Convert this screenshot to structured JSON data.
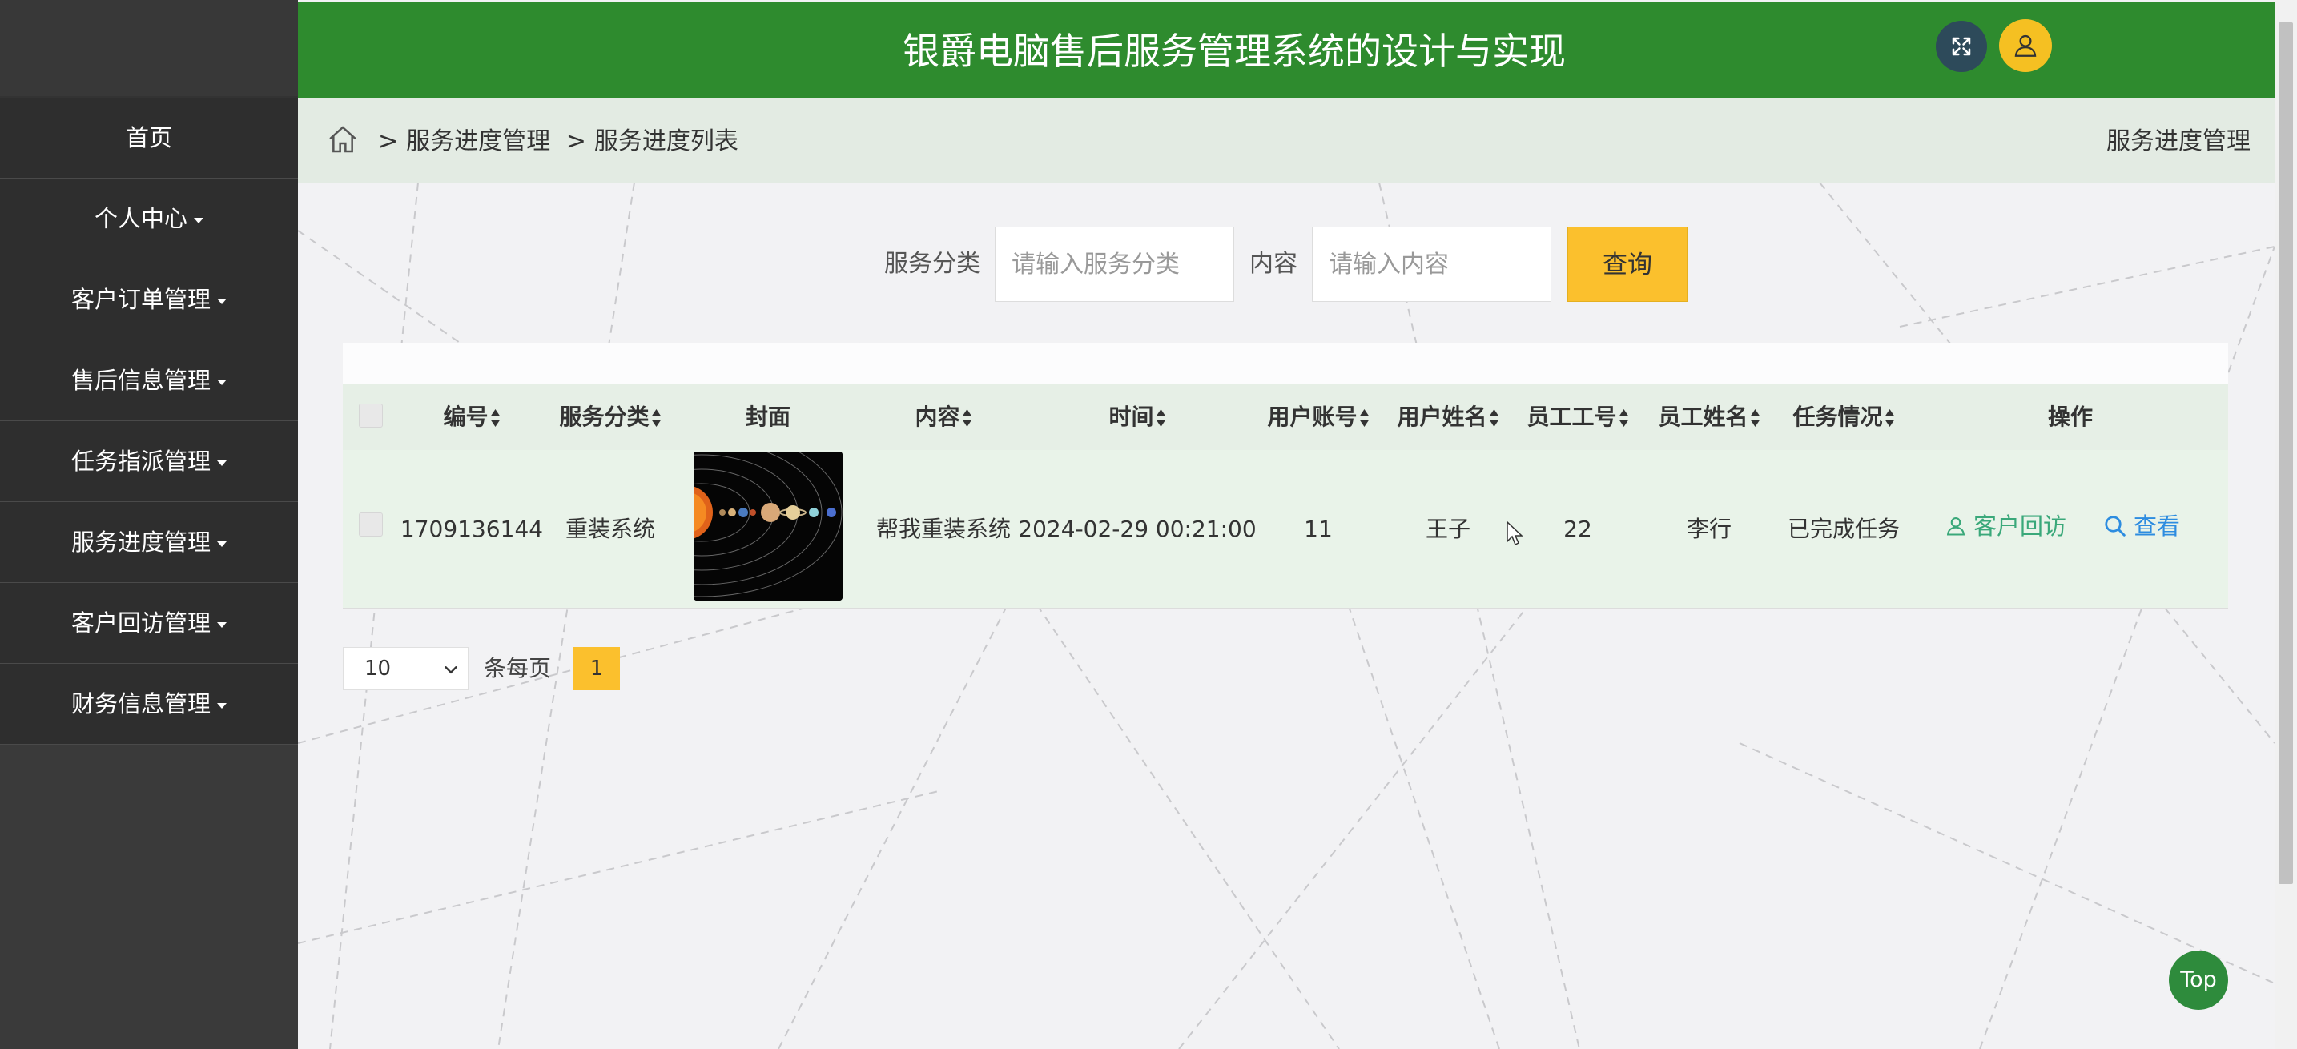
{
  "header": {
    "title": "银爵电脑售后服务管理系统的设计与实现"
  },
  "sidebar": {
    "items": [
      {
        "label": "首页",
        "has_caret": false
      },
      {
        "label": "个人中心",
        "has_caret": true
      },
      {
        "label": "客户订单管理",
        "has_caret": true
      },
      {
        "label": "售后信息管理",
        "has_caret": true
      },
      {
        "label": "任务指派管理",
        "has_caret": true
      },
      {
        "label": "服务进度管理",
        "has_caret": true
      },
      {
        "label": "客户回访管理",
        "has_caret": true
      },
      {
        "label": "财务信息管理",
        "has_caret": true
      }
    ]
  },
  "breadcrumb": {
    "items": [
      "服务进度管理",
      "服务进度列表"
    ],
    "separator": ">",
    "right_title": "服务进度管理"
  },
  "search": {
    "category_label": "服务分类",
    "category_placeholder": "请输入服务分类",
    "content_label": "内容",
    "content_placeholder": "请输入内容",
    "button_label": "查询"
  },
  "table": {
    "columns": [
      "编号",
      "服务分类",
      "封面",
      "内容",
      "时间",
      "用户账号",
      "用户姓名",
      "员工工号",
      "员工姓名",
      "任务情况",
      "操作"
    ],
    "rows": [
      {
        "id": "1709136144",
        "category": "重装系统",
        "cover": "solar-system-image",
        "content": "帮我重装系统",
        "time": "2024-02-29 00:21:00",
        "user_account": "11",
        "user_name": "王子",
        "employee_no": "22",
        "employee_name": "李行",
        "task_status": "已完成任务",
        "actions": {
          "revisit": "客户回访",
          "view": "查看"
        }
      }
    ]
  },
  "pagination": {
    "page_size": "10",
    "page_size_label": "条每页",
    "current_page": "1"
  },
  "top_button": "Top",
  "colors": {
    "header_green": "#2e8b2e",
    "sidebar_dark": "#2e2e2e",
    "accent_yellow": "#fbc02d",
    "link_green": "#3aa87a",
    "link_blue": "#2d8ce0"
  }
}
